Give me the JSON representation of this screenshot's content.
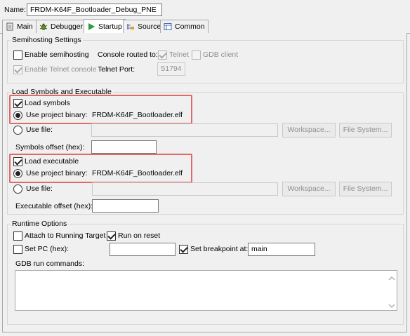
{
  "name_row": {
    "label": "Name:",
    "value": "FRDM-K64F_Bootloader_Debug_PNE"
  },
  "tabs": [
    {
      "label": "Main",
      "icon": "main-page-icon"
    },
    {
      "label": "Debugger",
      "icon": "debugger-bug-icon"
    },
    {
      "label": "Startup",
      "icon": "startup-play-icon",
      "active": true
    },
    {
      "label": "Source",
      "icon": "source-icon"
    },
    {
      "label": "Common",
      "icon": "common-icon"
    }
  ],
  "semihosting": {
    "title": "Semihosting Settings",
    "enable_semihosting": {
      "label": "Enable semihosting",
      "checked": false
    },
    "console_routed_label": "Console routed to:",
    "telnet": {
      "label": "Telnet",
      "checked": true,
      "enabled": false
    },
    "gdb_client": {
      "label": "GDB client",
      "checked": false,
      "enabled": false
    },
    "enable_telnet_console": {
      "label": "Enable Telnet console",
      "checked": true,
      "enabled": false
    },
    "telnet_port_label": "Telnet Port:",
    "telnet_port_value": "51794"
  },
  "load": {
    "title": "Load Symbols and Executable",
    "symbols": {
      "load_label": "Load symbols",
      "load_checked": true,
      "use_project_binary_label": "Use project binary:",
      "project_binary": "FRDM-K64F_Bootloader.elf",
      "use_file_label": "Use file:",
      "file_value": "",
      "workspace_label": "Workspace...",
      "filesystem_label": "File System...",
      "offset_label": "Symbols offset (hex):",
      "offset_value": ""
    },
    "executable": {
      "load_label": "Load executable",
      "load_checked": true,
      "use_project_binary_label": "Use project binary:",
      "project_binary": "FRDM-K64F_Bootloader.elf",
      "use_file_label": "Use file:",
      "file_value": "",
      "workspace_label": "Workspace...",
      "filesystem_label": "File System...",
      "offset_label": "Executable offset (hex):",
      "offset_value": ""
    }
  },
  "runtime": {
    "title": "Runtime Options",
    "attach_label": "Attach to Running Target",
    "attach_checked": false,
    "run_on_reset_label": "Run on reset",
    "run_on_reset_checked": true,
    "set_pc_label": "Set PC (hex):",
    "set_pc_checked": false,
    "set_pc_value": "",
    "set_breakpoint_label": "Set breakpoint at:",
    "set_breakpoint_checked": true,
    "breakpoint_value": "main",
    "gdb_commands_label": "GDB run commands:",
    "gdb_commands_value": ""
  },
  "colors": {
    "highlight": "#e06a6a",
    "play_green": "#2e9a3a"
  }
}
